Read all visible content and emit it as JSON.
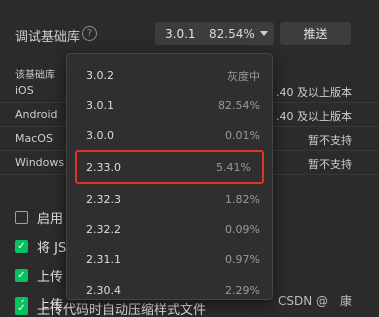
{
  "header": {
    "label": "调试基础库",
    "help_icon": "?",
    "selected_version": "3.0.1",
    "selected_percent": "82.54%",
    "push_label": "推送"
  },
  "info": {
    "description": "该基础库",
    "rows": [
      {
        "platform": "iOS",
        "support": ".40 及以上版本"
      },
      {
        "platform": "Android",
        "support": ".40 及以上版本"
      },
      {
        "platform": "MacOS",
        "support": "暂不支持"
      },
      {
        "platform": "Windows",
        "support": "暂不支持"
      }
    ]
  },
  "options": [
    {
      "checked": false,
      "label": "启用"
    },
    {
      "checked": true,
      "label": "将 JS"
    },
    {
      "checked": true,
      "label": "上传"
    },
    {
      "checked": true,
      "label": "上传"
    },
    {
      "checked": true,
      "label": "上传代码时自动压缩样式文件"
    }
  ],
  "watermark": "CSDN @　康",
  "dropdown": {
    "items": [
      {
        "version": "3.0.2",
        "percent": "灰度中",
        "highlighted": false
      },
      {
        "version": "3.0.1",
        "percent": "82.54%",
        "highlighted": false
      },
      {
        "version": "3.0.0",
        "percent": "0.01%",
        "highlighted": false
      },
      {
        "version": "2.33.0",
        "percent": "5.41%",
        "highlighted": true
      },
      {
        "version": "2.32.3",
        "percent": "1.82%",
        "highlighted": false
      },
      {
        "version": "2.32.2",
        "percent": "0.09%",
        "highlighted": false
      },
      {
        "version": "2.31.1",
        "percent": "0.97%",
        "highlighted": false
      },
      {
        "version": "2.30.4",
        "percent": "2.29%",
        "highlighted": false
      }
    ]
  },
  "colors": {
    "background": "#2b2b2b",
    "checkbox_on": "#07c160",
    "highlight_border": "#e0312b"
  }
}
